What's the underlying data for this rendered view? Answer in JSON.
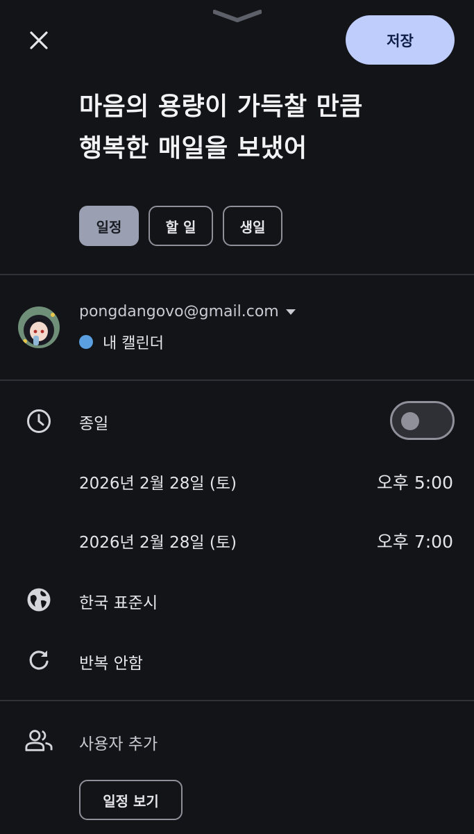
{
  "header": {
    "save_label": "저장"
  },
  "event": {
    "title_line1": "마음의 용량이 가득찰 만큼",
    "title_line2": "행복한 매일을 보냈어"
  },
  "type_chips": [
    {
      "label": "일정",
      "selected": true
    },
    {
      "label": "할 일",
      "selected": false
    },
    {
      "label": "생일",
      "selected": false
    }
  ],
  "account": {
    "email": "pongdangovo@gmail.com",
    "calendar_name": "내 캘린더",
    "calendar_color": "#5a9fe0"
  },
  "time": {
    "all_day_label": "종일",
    "all_day_on": false,
    "start_date": "2026년 2월 28일 (토)",
    "start_time": "오후 5:00",
    "end_date": "2026년 2월 28일 (토)",
    "end_time": "오후 7:00",
    "timezone": "한국 표준시",
    "repeat": "반복 안함"
  },
  "people": {
    "add_label": "사용자 추가",
    "view_schedule_label": "일정 보기"
  },
  "colors": {
    "background": "#131418",
    "accent_button": "#bfcdfd",
    "selected_chip": "#9aa0b2"
  }
}
